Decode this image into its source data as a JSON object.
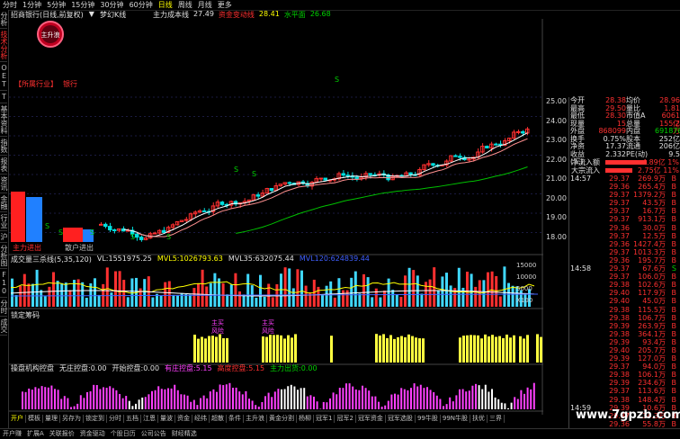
{
  "period_bar": [
    "分时",
    "1分钟",
    "5分钟",
    "15分钟",
    "30分钟",
    "60分钟",
    "日线",
    "周线",
    "月线",
    "更多"
  ],
  "period_active": 6,
  "left_tabs": [
    "分析",
    "技术分析",
    "OET",
    "T",
    "基本资料",
    "指数",
    "报表",
    "资讯",
    "金融",
    "行业",
    "沪",
    "分析图",
    "F10",
    "分时",
    "成交"
  ],
  "title": {
    "name": "招商银行(日线,前复权)",
    "arrow": "▼",
    "label": "梦幻K线"
  },
  "legend": [
    {
      "text": "主力成本线",
      "color": "wt"
    },
    {
      "text": "27.49",
      "color": "wt"
    },
    {
      "text": "资金变动线",
      "color": "rd"
    },
    {
      "text": "28.41",
      "color": "yl"
    },
    {
      "text": "水平面",
      "color": "gn"
    },
    {
      "text": "26.68",
      "color": "gn"
    }
  ],
  "logo_text": "主升浪",
  "sector_label": "【所属行业】",
  "sector_value": "银行",
  "flow_labels": {
    "main": "主力进出",
    "retail": "散户进出"
  },
  "signal_letter": "S",
  "panel1": {
    "title": "成交量三杀线(5,35,120)",
    "vol_label": "VL:",
    "vol": "1551975.25",
    "mv5_label": "MVL5:",
    "mv5": "1026793.63",
    "mv35_label": "MVL35:",
    "mv35": "632075.44",
    "mv120_label": "MVL120:",
    "mv120": "624839.44"
  },
  "panel1_axis": [
    "15000",
    "10000",
    "5000",
    "X100"
  ],
  "panel2": {
    "title": "锁定筹码"
  },
  "panel2_tags": [
    {
      "t1": "主买",
      "t2": "风险"
    },
    {
      "t1": "主买",
      "t2": "风险"
    }
  ],
  "panel3": {
    "title": "操盘机构控盘",
    "a_label": "无庄控盘:",
    "a": "0.00",
    "b_label": "开始控盘:",
    "b": "0.00",
    "c_label": "有庄控盘:",
    "c": "5.15",
    "d_label": "高度控盘:",
    "d": "5.15",
    "e_label": "主力出货:",
    "e": "0.00"
  },
  "price_axis": [
    "25.00",
    "24.00",
    "23.00",
    "22.00",
    "21.00",
    "20.00",
    "19.00",
    "18.00"
  ],
  "time_axis": [
    "2017年",
    "3",
    "4",
    "5",
    "6",
    "7",
    "8",
    "9",
    "10",
    "11"
  ],
  "bottom_tabs": [
    "开户",
    "模板",
    "量理",
    "另存为",
    "锁定到",
    "分时",
    "五档",
    "江恩",
    "量波",
    "资金",
    "经纬",
    "超散",
    "条件",
    "主升浪",
    "黄金分割",
    "杨柳",
    "冠军1",
    "冠军2",
    "冠军资金",
    "冠军选股",
    "99牛股",
    "99N牛股",
    "扶优",
    "三界"
  ],
  "bottom_tab_active": 0,
  "status_bar": [
    "开户赚",
    "扩展A",
    "关联报价",
    "资金驱动",
    "个股日历",
    "公司公告",
    "财经精选"
  ],
  "quote": {
    "rows": [
      [
        "今开",
        "28.38",
        "均价",
        "28.96"
      ],
      [
        "最高",
        "29.50",
        "量比",
        "1.81"
      ],
      [
        "最低",
        "28.30",
        "市值A",
        "6061亿"
      ],
      [
        "现量",
        "15",
        "总量",
        "155.2万"
      ],
      [
        "外盘",
        "868099",
        "内盘",
        "691876"
      ],
      [
        "换手",
        "0.75%",
        "股本",
        "252亿"
      ],
      [
        "净资",
        "17.37",
        "流通",
        "206亿"
      ],
      [
        "收益(三)",
        "2.332",
        "PE(动)",
        "9.5"
      ]
    ],
    "flows": [
      {
        "label": "净流入额",
        "value": "4.89亿",
        "unit": "1%"
      },
      {
        "label": "大宗流入",
        "value": "2.75亿",
        "unit": "11%"
      }
    ],
    "ticks_time1": "14:57",
    "ticks_time2": "14:58",
    "ticks_time3": "14:59",
    "ticks": [
      [
        "29.37",
        "269.9万",
        "B"
      ],
      [
        "29.36",
        "265.4万",
        "B"
      ],
      [
        "29.37",
        "1379.2万",
        "B"
      ],
      [
        "29.37",
        "43.5万",
        "B"
      ],
      [
        "29.37",
        "16.7万",
        "B"
      ],
      [
        "29.37",
        "913.1万",
        "B"
      ],
      [
        "29.36",
        "30.0万",
        "B"
      ],
      [
        "29.37",
        "12.5万",
        "B"
      ],
      [
        "29.36",
        "1427.4万",
        "B"
      ],
      [
        "29.37",
        "1013.3万",
        "B"
      ],
      [
        "29.36",
        "195.7万",
        "B"
      ],
      [
        "29.37",
        "67.6万",
        "S"
      ],
      [
        "29.37",
        "106.0万",
        "B"
      ],
      [
        "29.38",
        "102.6万",
        "B"
      ],
      [
        "29.40",
        "117.9万",
        "B"
      ],
      [
        "29.40",
        "45.0万",
        "B"
      ],
      [
        "29.38",
        "115.5万",
        "B"
      ],
      [
        "29.38",
        "106.7万",
        "B"
      ],
      [
        "29.39",
        "263.9万",
        "B"
      ],
      [
        "29.38",
        "364.1万",
        "B"
      ],
      [
        "29.39",
        "93.4万",
        "B"
      ],
      [
        "29.40",
        "205.7万",
        "B"
      ],
      [
        "29.39",
        "127.0万",
        "B"
      ],
      [
        "29.37",
        "94.0万",
        "B"
      ],
      [
        "29.38",
        "106.1万",
        "B"
      ],
      [
        "29.39",
        "234.6万",
        "B"
      ],
      [
        "29.37",
        "113.6万",
        "B"
      ],
      [
        "29.38",
        "148.4万",
        "B"
      ],
      [
        "29.39",
        "10.6万",
        "B"
      ],
      [
        "29.37",
        "34.3万",
        "B"
      ],
      [
        "29.36",
        "55.8万",
        "B"
      ]
    ]
  },
  "watermark": "www.7gpzb.com",
  "colors": {
    "up": "#ff3030",
    "down": "#00e0e0",
    "ma_white": "#ffffff",
    "ma_yellow": "#ffff00",
    "ma_green": "#00c000",
    "vol_up": "#ff3030",
    "vol_down": "#40d8ff",
    "lock": "#ffff40",
    "ctrl": "#ff40ff"
  }
}
